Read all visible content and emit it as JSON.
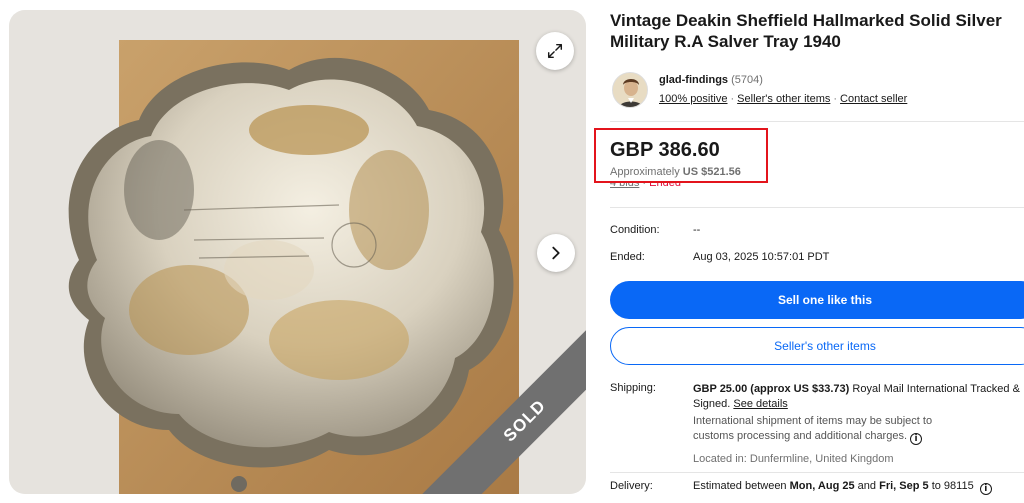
{
  "listing": {
    "title": "Vintage Deakin Sheffield Hallmarked Solid Silver Military R.A Salver Tray 1940",
    "sold_badge": "SOLD"
  },
  "seller": {
    "name": "glad-findings",
    "feedback_count": "(5704)",
    "positive": "100% positive",
    "other_items": "Seller's other items",
    "contact": "Contact seller",
    "separator": "·"
  },
  "price": {
    "amount": "GBP 386.60",
    "approx_prefix": "Approximately",
    "approx_value": "US $521.56",
    "bids": "4 bids",
    "separator": "·",
    "status": "Ended"
  },
  "details": {
    "condition_label": "Condition:",
    "condition_value": "--",
    "ended_label": "Ended:",
    "ended_value": "Aug 03, 2025 10:57:01 PDT"
  },
  "actions": {
    "sell_one_like_this": "Sell one like this",
    "sellers_other_items": "Seller's other items"
  },
  "shipping": {
    "label": "Shipping:",
    "cost": "GBP 25.00 (approx US $33.73)",
    "service": "Royal Mail International Tracked & Signed.",
    "see_details": "See details",
    "note": "International shipment of items may be subject to customs processing and additional charges.",
    "location": "Located in: Dunfermline, United Kingdom"
  },
  "delivery": {
    "label": "Delivery:",
    "prefix": "Estimated between",
    "start": "Mon, Aug 25",
    "and": "and",
    "end": "Fri, Sep 5",
    "to": "to 98115"
  },
  "colors": {
    "primary_blue": "#0968f6",
    "highlight_red": "#e3141c",
    "ended_red": "#e0103a",
    "sold_ribbon": "#707070"
  }
}
